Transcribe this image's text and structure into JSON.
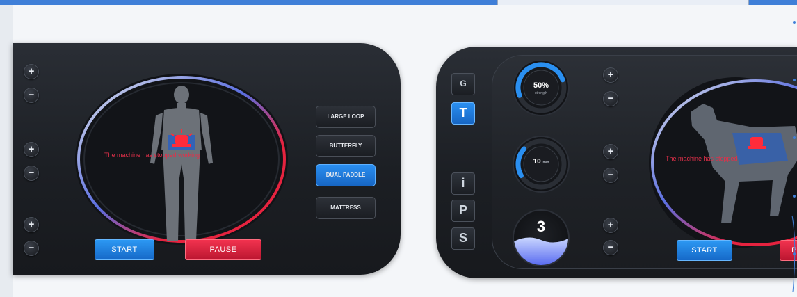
{
  "left_panel": {
    "status_text": "The machine has stopped working",
    "modes": [
      {
        "label": "LARGE LOOP",
        "active": false
      },
      {
        "label": "BUTTERFLY",
        "active": false
      },
      {
        "label": "DUAL PADDLE",
        "active": true
      },
      {
        "label": "MATTRESS",
        "active": false
      }
    ],
    "start_label": "START",
    "pause_label": "PAUSE",
    "plus": "+",
    "minus": "−"
  },
  "right_panel": {
    "side_buttons": [
      {
        "label": "G",
        "icon": "probe-icon"
      },
      {
        "label": "T",
        "icon": "t-icon",
        "active": true
      },
      {
        "label": "i",
        "icon": "info-icon"
      },
      {
        "label": "P",
        "icon": "p-icon"
      },
      {
        "label": "S",
        "icon": "s-icon"
      }
    ],
    "intensity": {
      "value": "50%",
      "unit": "strength",
      "fraction": 0.5
    },
    "time": {
      "value": "10",
      "unit": "min",
      "fraction": 0.2
    },
    "level": {
      "value": "3"
    },
    "status_text": "The machine has stopped",
    "start_label": "START",
    "pause_label": "P",
    "plus": "+",
    "minus": "−"
  },
  "colors": {
    "accent_blue": "#1f86ea",
    "accent_red": "#e6233f",
    "panel": "#1d2025"
  }
}
